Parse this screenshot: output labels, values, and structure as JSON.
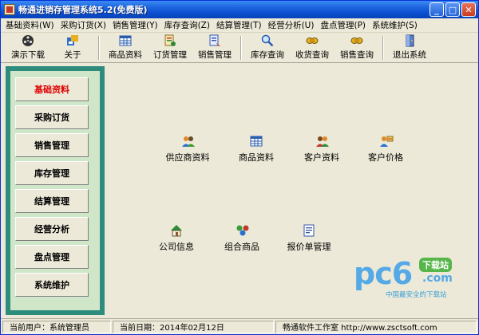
{
  "window": {
    "title": "畅通进销存管理系统5.2(免费版)",
    "buttons": {
      "minimize": "_",
      "maximize": "□",
      "close": "✕"
    }
  },
  "menubar": [
    "基础资料(W)",
    "采购订货(X)",
    "销售管理(Y)",
    "库存查询(Z)",
    "结算管理(T)",
    "经营分析(U)",
    "盘点管理(P)",
    "系统维护(S)"
  ],
  "toolbar": [
    {
      "label": "演示下载",
      "icon": "film-reel-icon"
    },
    {
      "label": "关于",
      "icon": "about-icon"
    },
    {
      "label": "商品资料",
      "icon": "product-grid-icon"
    },
    {
      "label": "订货管理",
      "icon": "order-icon"
    },
    {
      "label": "销售管理",
      "icon": "sales-icon"
    },
    {
      "label": "库存查询",
      "icon": "inventory-search-icon"
    },
    {
      "label": "收货查询",
      "icon": "receipt-search-icon"
    },
    {
      "label": "销售查询",
      "icon": "sales-search-icon"
    },
    {
      "label": "退出系统",
      "icon": "exit-door-icon"
    }
  ],
  "nav": [
    {
      "label": "基础资料",
      "active": true
    },
    {
      "label": "采购订货",
      "active": false
    },
    {
      "label": "销售管理",
      "active": false
    },
    {
      "label": "库存管理",
      "active": false
    },
    {
      "label": "结算管理",
      "active": false
    },
    {
      "label": "经营分析",
      "active": false
    },
    {
      "label": "盘点管理",
      "active": false
    },
    {
      "label": "系统维护",
      "active": false
    }
  ],
  "modules": [
    {
      "label": "供应商资料",
      "icon": "supplier-people-icon"
    },
    {
      "label": "商品资料",
      "icon": "product-grid-icon"
    },
    {
      "label": "客户资料",
      "icon": "customer-people-icon"
    },
    {
      "label": "客户价格",
      "icon": "customer-price-icon"
    },
    {
      "label": "公司信息",
      "icon": "company-house-icon"
    },
    {
      "label": "组合商品",
      "icon": "combo-product-icon"
    },
    {
      "label": "报价单管理",
      "icon": "quote-document-icon"
    }
  ],
  "watermark": {
    "brand": "pc6",
    "badge": "下载站",
    "suffix": ".com",
    "tagline": "中国最安全的下载站"
  },
  "status": {
    "user": "当前用户：系统管理员",
    "date": "当前日期：2014年02月12日",
    "company": "畅通软件工作室 http://www.zsctsoft.com"
  },
  "colors": {
    "titlebar": "#0a4fd0",
    "nav_panel": "#2d8c7c",
    "nav_inner": "#cfe6c9",
    "active_nav": "#e00000",
    "watermark": "#55a9e6"
  }
}
